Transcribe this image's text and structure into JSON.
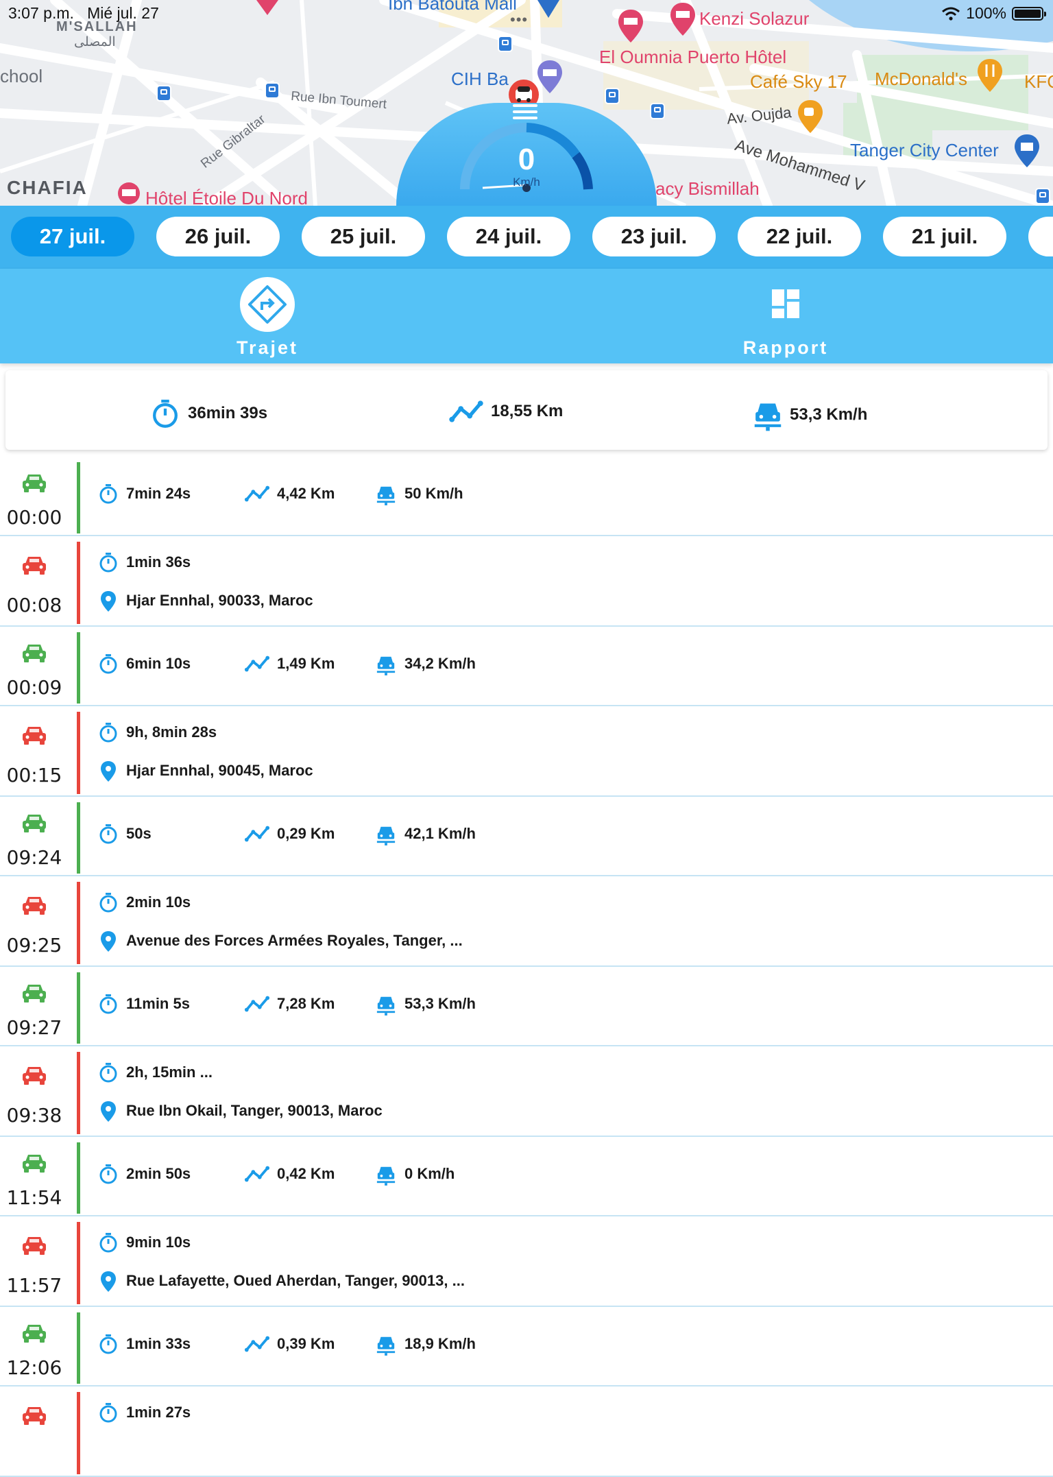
{
  "status_bar": {
    "time": "3:07 p.m.",
    "date": "Mié jul. 27",
    "battery": "100%"
  },
  "map": {
    "labels": {
      "ibn_batouta": "Ibn Batouta Mall",
      "kenzi": "Kenzi Solazur",
      "msallah": "M'SALLAH",
      "msallah_ar": "المصلى",
      "school": "chool",
      "cih": "CIH Ba",
      "oumnia": "El Oumnia Puerto Hôtel",
      "cafe_sky": "Café Sky 17",
      "mcdonalds": "McDonald's",
      "kfc": "KFC",
      "ibn_toumert": "Rue Ibn Toumert",
      "gibraltar": "Rue Gibraltar",
      "oujda": "Av. Oujda",
      "tanger_city": "Tanger City Center",
      "mohammed": "Ave Mohammed V",
      "chafia": "CHAFIA",
      "etoile": "Hôtel Étoile Du Nord",
      "bismillah": "acy Bismillah"
    }
  },
  "speedometer": {
    "value": "0",
    "unit": "Km/h"
  },
  "dates": [
    "27 juil.",
    "26 juil.",
    "25 juil.",
    "24 juil.",
    "23 juil.",
    "22 juil.",
    "21 juil."
  ],
  "tabs": {
    "trajet": "Trajet",
    "rapport": "Rapport"
  },
  "summary": {
    "duration": "36min 39s",
    "distance": "18,55 Km",
    "speed": "53,3 Km/h"
  },
  "colors": {
    "drive": "#4caf50",
    "stop": "#e8453c",
    "accent": "#1a9be8",
    "tab_bar": "#55c2f6"
  },
  "trips": [
    {
      "type": "drive",
      "time": "00:00",
      "duration": "7min 24s",
      "distance": "4,42 Km",
      "speed": "50 Km/h"
    },
    {
      "type": "stop",
      "time": "00:08",
      "duration": "1min 36s",
      "address": "Hjar Ennhal, 90033, Maroc"
    },
    {
      "type": "drive",
      "time": "00:09",
      "duration": "6min 10s",
      "distance": "1,49 Km",
      "speed": "34,2 Km/h"
    },
    {
      "type": "stop",
      "time": "00:15",
      "duration": "9h, 8min 28s",
      "address": "Hjar Ennhal, 90045, Maroc"
    },
    {
      "type": "drive",
      "time": "09:24",
      "duration": "50s",
      "distance": "0,29 Km",
      "speed": "42,1 Km/h"
    },
    {
      "type": "stop",
      "time": "09:25",
      "duration": "2min 10s",
      "address": "Avenue des Forces Armées Royales, Tanger, ..."
    },
    {
      "type": "drive",
      "time": "09:27",
      "duration": "11min 5s",
      "distance": "7,28 Km",
      "speed": "53,3 Km/h"
    },
    {
      "type": "stop",
      "time": "09:38",
      "duration": "2h, 15min ...",
      "address": "Rue Ibn Okail, Tanger, 90013, Maroc"
    },
    {
      "type": "drive",
      "time": "11:54",
      "duration": "2min 50s",
      "distance": "0,42 Km",
      "speed": "0 Km/h"
    },
    {
      "type": "stop",
      "time": "11:57",
      "duration": "9min 10s",
      "address": "Rue Lafayette, Oued Aherdan, Tanger, 90013, ..."
    },
    {
      "type": "drive",
      "time": "12:06",
      "duration": "1min 33s",
      "distance": "0,39 Km",
      "speed": "18,9 Km/h"
    },
    {
      "type": "stop",
      "time": "",
      "duration": "1min 27s",
      "address": ""
    }
  ]
}
